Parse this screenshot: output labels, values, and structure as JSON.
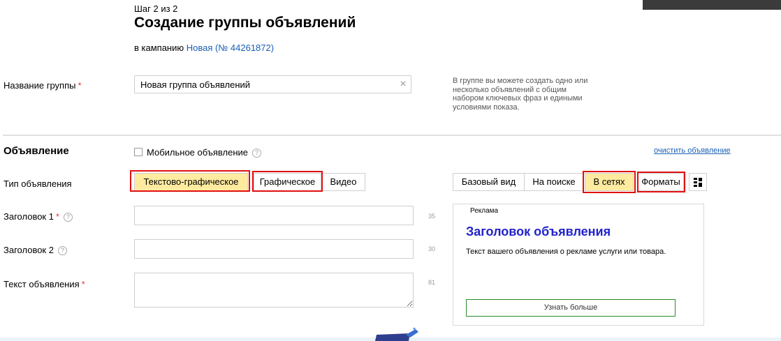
{
  "header": {
    "step": "Шаг 2 из 2",
    "title": "Создание группы объявлений",
    "campaign_prefix": "в кампанию",
    "campaign_link": "Новая (№ 44261872)"
  },
  "group": {
    "label": "Название группы",
    "required_mark": "*",
    "value": "Новая группа объявлений",
    "hint": "В группе вы можете создать одно или несколько объявлений с общим набором ключевых фраз и едиными условиями показа."
  },
  "ad": {
    "section_title": "Объявление",
    "mobile_label": "Мобильное объявление",
    "mobile_help": "?",
    "clear_link": "очистить объявление",
    "type_label": "Тип объявления",
    "types": [
      "Текстово-графическое",
      "Графическое",
      "Видео"
    ],
    "fields": {
      "title1_label": "Заголовок 1",
      "title1_counter": "35",
      "title2_label": "Заголовок 2",
      "title2_counter": "30",
      "text_label": "Текст объявления",
      "text_counter": "81",
      "help": "?"
    }
  },
  "preview": {
    "tabs": [
      "Базовый вид",
      "На поиске",
      "В сетях",
      "Форматы"
    ],
    "active_tab": "В сетях",
    "ad_tag": "Реклама",
    "ad_title": "Заголовок объявления",
    "ad_text": "Текст вашего объявления о рекламе услуги или товара.",
    "ad_button": "Узнать больше"
  },
  "colors": {
    "active": "#ffeba0",
    "highlight": "#e01010",
    "link": "#1a5fb4",
    "ad_title": "#2222cc"
  }
}
